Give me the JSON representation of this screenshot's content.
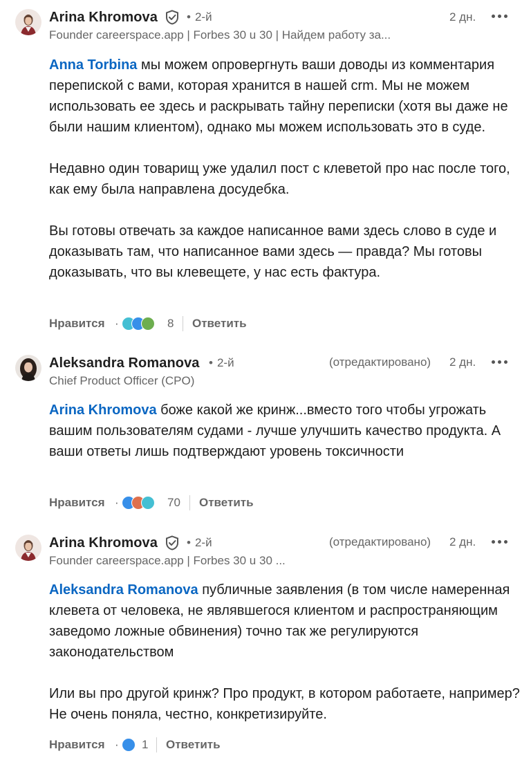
{
  "comments": [
    {
      "author": "Arina Khromova",
      "degree": "2-й",
      "headline": "Founder careerspace.app | Forbes 30 u 30 | Найдем работу за...",
      "edited": "",
      "time": "2 дн.",
      "mention": "Anna Torbina",
      "first_text": " мы можем опровергнуть ваши доводы из комментария перепиской с вами, которая хранится в нашей crm. Мы не можем использовать ее здесь и раскрывать тайну переписки (хотя вы даже не были нашим клиентом), однако мы можем использовать это в суде.",
      "paragraphs": [
        "Недавно один товарищ уже удалил пост с клеветой про нас после того, как ему была направлена досудебка.",
        "Вы готовы отвечать за каждое написанное вами здесь слово в суде и доказывать там, что написанное вами здесь — правда? Мы готовы доказывать, что вы клевещете, у нас есть фактура."
      ],
      "like_label": "Нравится",
      "reactions_count": "8",
      "reply_label": "Ответить",
      "reaction_icons": [
        "funny-reaction-icon",
        "like-reaction-icon",
        "support-reaction-icon"
      ]
    },
    {
      "author": "Aleksandra Romanova",
      "degree": "2-й",
      "headline": "Chief Product Officer (CPO)",
      "edited": "(отредактировано)",
      "time": "2 дн.",
      "mention": "Arina Khromova",
      "first_text": " боже какой же кринж...вместо того чтобы угрожать вашим пользователям судами - лучше улучшить качество продукта. А ваши ответы лишь подтверждают уровень токсичности",
      "paragraphs": [],
      "like_label": "Нравится",
      "reactions_count": "70",
      "reply_label": "Ответить",
      "reaction_icons": [
        "like-reaction-icon",
        "support-reaction-icon",
        "funny-reaction-icon"
      ]
    },
    {
      "author": "Arina Khromova",
      "degree": "2-й",
      "headline": "Founder careerspace.app | Forbes 30 u 30 ...",
      "edited": "(отредактировано)",
      "time": "2 дн.",
      "mention": "Aleksandra Romanova",
      "first_text": " публичные заявления (в том числе намеренная клевета от человека, не являвшегося клиентом и распространяющим заведомо ложные обвинения) точно так же регулируются законодательством",
      "paragraphs": [
        "Или вы про другой кринж? Про продукт, в котором работаете, например? Не очень поняла, честно, конкретизируйте."
      ],
      "like_label": "Нравится",
      "reactions_count": "1",
      "reply_label": "Ответить",
      "reaction_icons": [
        "like-reaction-icon"
      ]
    }
  ],
  "colors": {
    "mention": "#0a66c2",
    "text": "#1d1d1d",
    "secondary": "#666666",
    "like_blue": "#378fe9",
    "funny_teal": "#44bfd3",
    "support_green": "#6dae4f",
    "love_pink": "#df704d"
  }
}
